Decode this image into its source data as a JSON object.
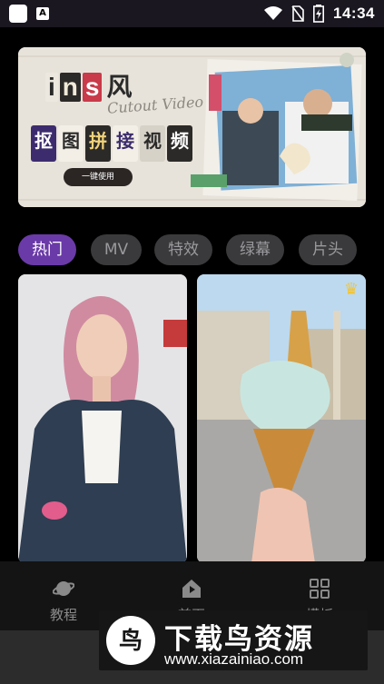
{
  "status_bar": {
    "time": "14:34",
    "left_icons": [
      "app-icon",
      "a-icon"
    ],
    "right_icons": [
      "wifi-icon",
      "sim-icon",
      "battery-charging-icon"
    ]
  },
  "banner": {
    "title_letters": [
      "i",
      "n",
      "s"
    ],
    "title_char": "风",
    "cutout_chars": [
      "抠",
      "图",
      "拼",
      "接",
      "视",
      "频"
    ],
    "script_text": "Cutout Video",
    "button_label": "一键使用"
  },
  "chips": {
    "items": [
      "热门",
      "MV",
      "特效",
      "绿幕",
      "片头"
    ],
    "active_index": 0
  },
  "cards": {
    "left_icon": "portrait-photo",
    "right_icon": "ice-cream-photo",
    "right_badge_icon": "crown-icon"
  },
  "bottom_nav": {
    "items": [
      {
        "label": "教程",
        "icon": "planet-icon"
      },
      {
        "label": "首页",
        "icon": "home-icon"
      },
      {
        "label": "模板",
        "icon": "grid-icon"
      }
    ]
  },
  "watermark": {
    "title": "下载鸟资源",
    "url": "www.xiazainiao.com",
    "logo_char": "鸟"
  },
  "colors": {
    "accent": "#6a3aa8",
    "chip_bg": "#3a3a3c",
    "chip_text": "#9a9a9e",
    "nav_bg": "#141414"
  }
}
